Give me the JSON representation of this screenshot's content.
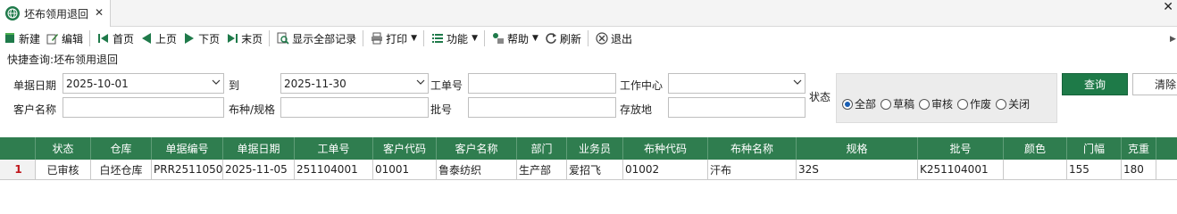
{
  "tab": {
    "title": "坯布领用退回",
    "close": "✕"
  },
  "window": {
    "close": "✕"
  },
  "toolbar": {
    "new": "新建",
    "edit": "编辑",
    "first": "首页",
    "prev": "上页",
    "next": "下页",
    "last": "末页",
    "show_all": "显示全部记录",
    "print": "打印",
    "function": "功能",
    "help": "帮助",
    "refresh": "刷新",
    "exit": "退出"
  },
  "query": {
    "title": "快捷查询:坯布领用退回",
    "date_label": "单据日期",
    "date_from": "2025-10-01",
    "to_label": "到",
    "date_to": "2025-11-30",
    "job_no_label": "工单号",
    "job_no": "",
    "work_center_label": "工作中心",
    "work_center": "",
    "customer_label": "客户名称",
    "customer": "",
    "fabric_label": "布种/规格",
    "fabric": "",
    "batch_label": "批号",
    "batch": "",
    "storage_label": "存放地",
    "storage": "",
    "status_label": "状态",
    "status_options": [
      "全部",
      "草稿",
      "审核",
      "作废",
      "关闭"
    ],
    "status_selected": "全部",
    "query_button": "查询",
    "clear_button": "清除"
  },
  "grid": {
    "columns": [
      "状态",
      "仓库",
      "单据编号",
      "单据日期",
      "工单号",
      "客户代码",
      "客户名称",
      "部门",
      "业务员",
      "布种代码",
      "布种名称",
      "规格",
      "批号",
      "颜色",
      "门幅",
      "克重"
    ],
    "rows": [
      {
        "rownum": "1",
        "cells": [
          "已审核",
          "白坯仓库",
          "PRR2511050",
          "2025-11-05",
          "251104001",
          "01001",
          "鲁泰纺织",
          "生产部",
          "爱招飞",
          "01002",
          "汗布",
          "32S",
          "K251104001",
          "",
          "155",
          "180"
        ]
      }
    ]
  },
  "colors": {
    "accent_green": "#2f7d4f",
    "query_btn": "#1e7a48",
    "row_number": "#c0161c"
  }
}
